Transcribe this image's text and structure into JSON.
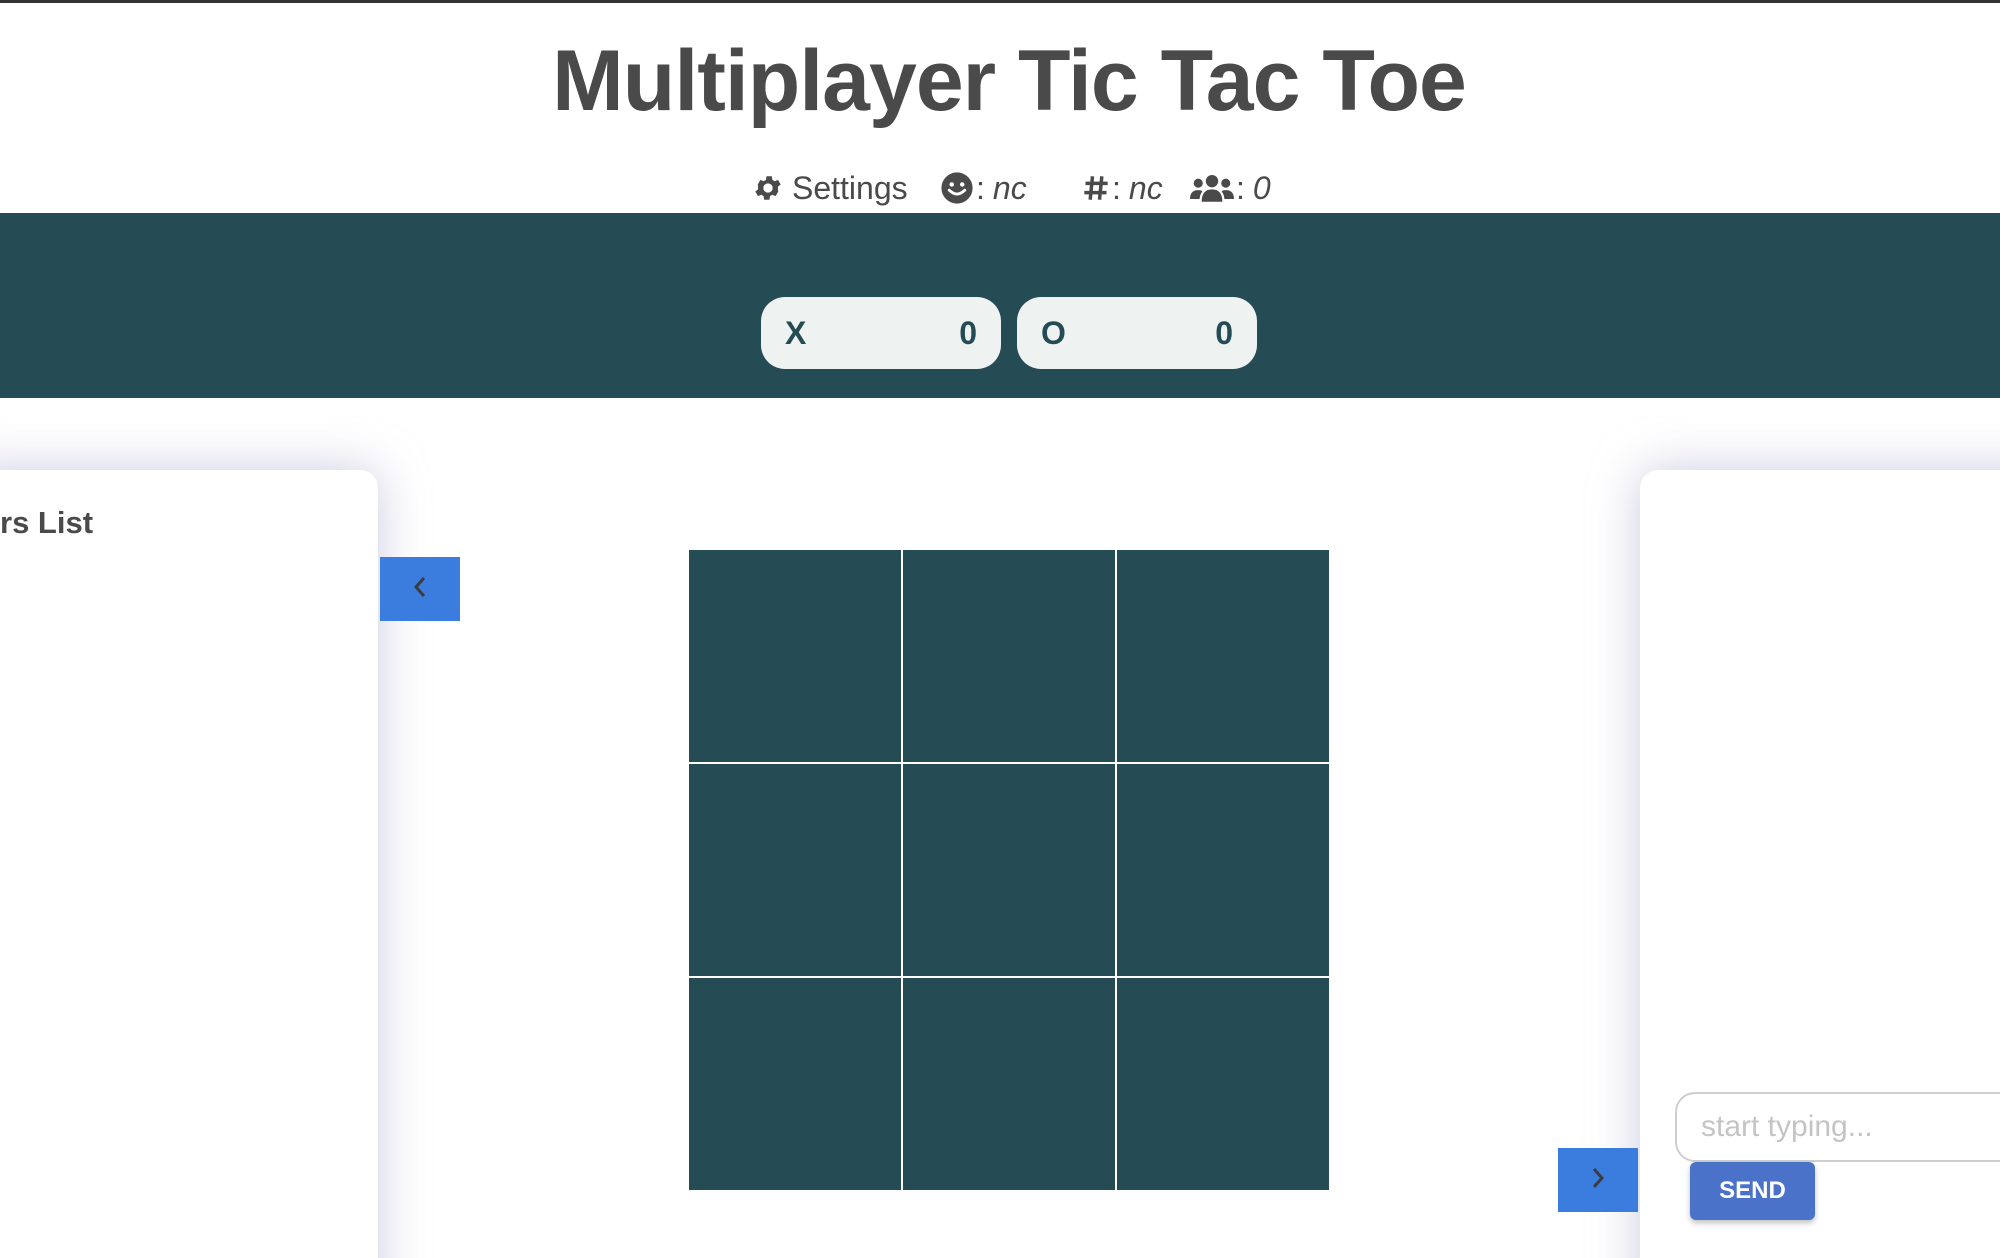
{
  "header": {
    "title": "Multiplayer Tic Tac Toe"
  },
  "infobar": {
    "settings_label": "Settings",
    "player_sep": ":",
    "player_value": "nc",
    "room_sep": ":",
    "room_value": "nc",
    "users_sep": ":",
    "users_value": "0",
    "icons": [
      "gear-icon",
      "smile-icon",
      "hash-icon",
      "users-icon"
    ]
  },
  "scores": [
    {
      "label": "X",
      "value": "0"
    },
    {
      "label": "O",
      "value": "0"
    }
  ],
  "left_panel": {
    "title": "rs List"
  },
  "chat": {
    "input_placeholder": "start typing...",
    "send_label": "SEND"
  },
  "colors": {
    "band": "#254c55",
    "cell": "#254c55",
    "nav_button": "#3b7dde",
    "send_button": "#4a72c8",
    "score_pill": "#eef2f1"
  }
}
